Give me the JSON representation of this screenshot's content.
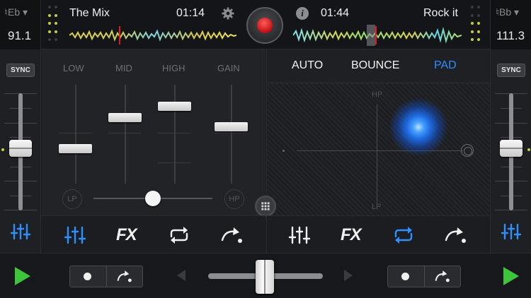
{
  "deck_a": {
    "key": "♮Eb ▾",
    "bpm": "91.1",
    "title": "The Mix",
    "time": "01:14",
    "waveform": "deck-a-waveform"
  },
  "deck_b": {
    "key": "♮Bb ▾",
    "bpm": "111.3",
    "title": "Rock it",
    "time": "01:44",
    "waveform": "deck-b-waveform"
  },
  "icons": {
    "gear": "gear-icon",
    "info_glyph": "i",
    "record": "record-icon"
  },
  "sync_label": "SYNC",
  "mixer": {
    "eq_labels": [
      "LOW",
      "MID",
      "HIGH",
      "GAIN"
    ],
    "eq_levels": [
      0.43,
      0.75,
      0.88,
      0.57
    ],
    "filter_lp": "LP",
    "filter_hp": "HP",
    "filter_position": 0.5
  },
  "pad_modes": {
    "auto": "AUTO",
    "bounce": "BOUNCE",
    "pad": "PAD",
    "active": "PAD"
  },
  "xy_pad": {
    "top_label": "HP",
    "bottom_label": "LP"
  },
  "toolbar": {
    "fx_label": "FX"
  },
  "pitch": {
    "left_value": 0.5,
    "right_value": 0.5
  },
  "crossfader": {
    "position": 0.5
  },
  "colors": {
    "accent_blue": "#2e8fff",
    "play_green": "#3cc43a",
    "record_red": "#e01a1e",
    "beat_yellow": "#c6d13a"
  }
}
